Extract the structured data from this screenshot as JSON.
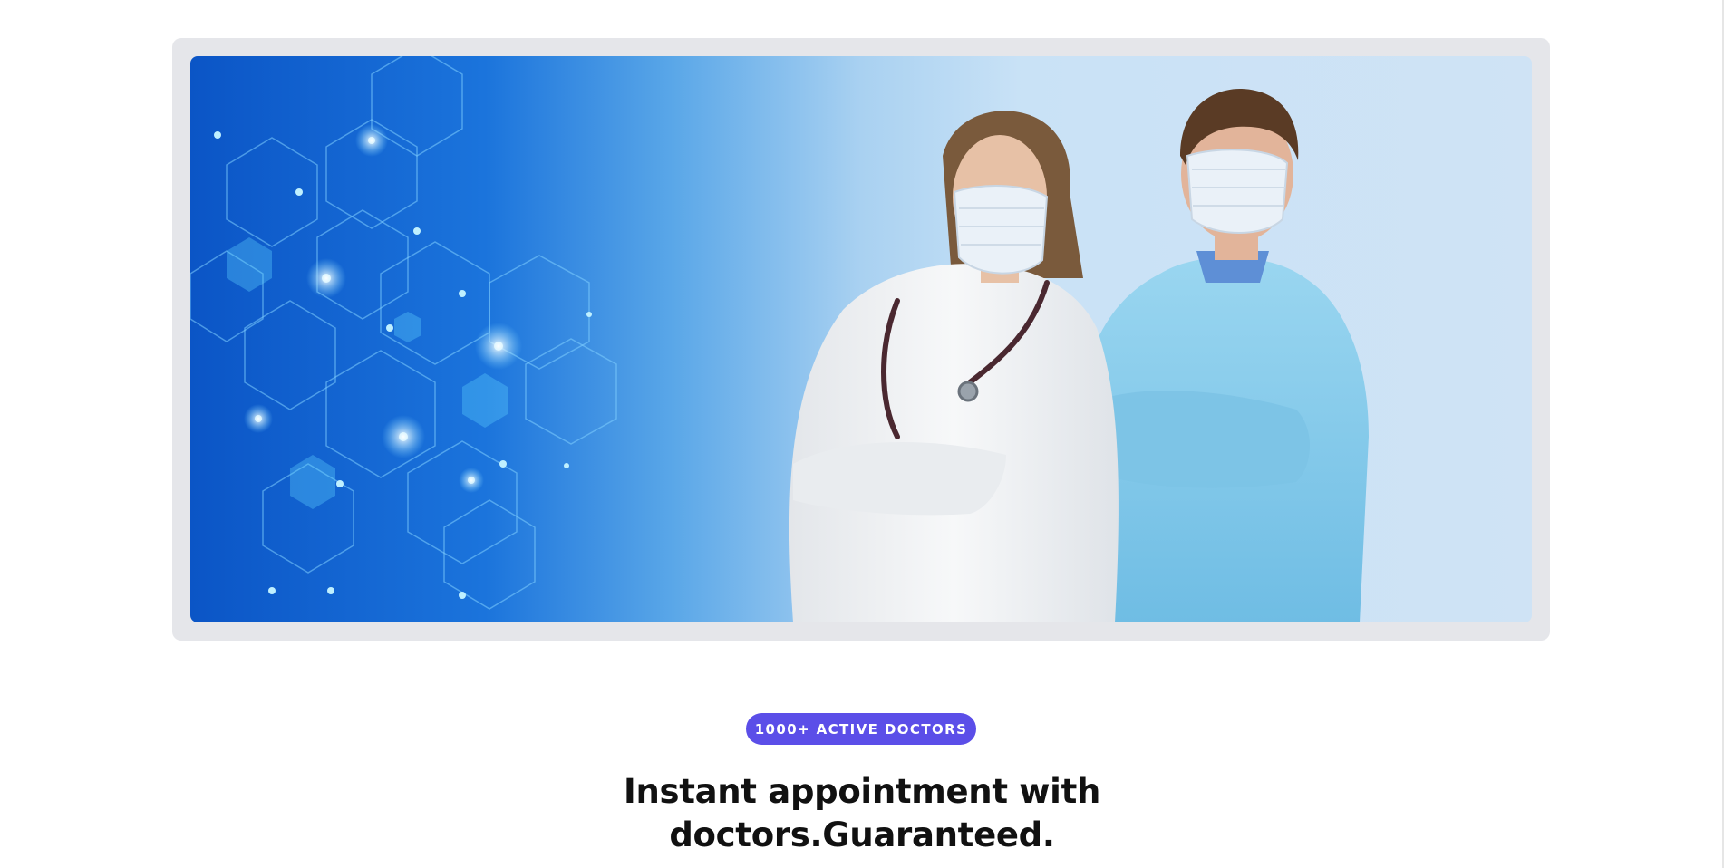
{
  "hero": {
    "image_alt": "Two doctors wearing surgical masks standing with crossed arms in front of a blue hexagon molecular background",
    "colors": {
      "frame": "#e5e6ea",
      "gradient_left": "#0b55c6",
      "gradient_right": "#cfe3f5",
      "white_coat": "#f2f3f5",
      "blue_gown": "#8ccdec",
      "mask": "#eaf1f8"
    }
  },
  "badge": {
    "label": "1000+ ACTIVE DOCTORS",
    "color": "#5b4ee8"
  },
  "heading": {
    "line1": "Instant appointment with",
    "line2": "doctors.Guaranteed."
  }
}
